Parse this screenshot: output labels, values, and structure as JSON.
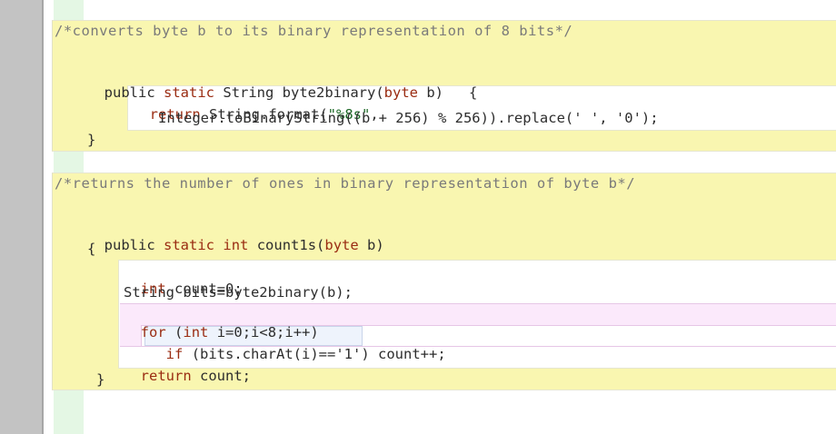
{
  "editor": {
    "method1": {
      "comment": "/*converts byte b to its binary representation of 8 bits*/",
      "kw_public": "public",
      "kw_static": "static",
      "sig_text": "String byte2binary(",
      "kw_byte": "byte",
      "param": "b)",
      "open_brace": "{",
      "kw_return": "return",
      "return_text": "String.format(",
      "format_str": "\"%8s\"",
      "return_comma": ",",
      "line2": "Integer.toBinaryString((b + 256) % 256)).replace(' ', '0');",
      "close_brace": "}"
    },
    "method2": {
      "comment": "/*returns the number of ones in binary representation of byte b*/",
      "kw_public": "public",
      "kw_static": "static",
      "kw_int": "int",
      "name": "count1s(",
      "kw_byte": "byte",
      "param": "b)",
      "open_brace": "{",
      "decl_kw": "int",
      "decl_rest": "count=0;",
      "bits_line": "String bits=byte2binary(b);",
      "for_kw": "for",
      "for_int": "int",
      "for_rest": "i=0;i<8;i++)",
      "for_open_paren": "(",
      "if_kw": "if",
      "if_cond": "(bits.charAt(i)=='1')",
      "if_body": "count++;",
      "return_kw": "return",
      "return_rest": "count;",
      "close_brace": "}"
    }
  }
}
